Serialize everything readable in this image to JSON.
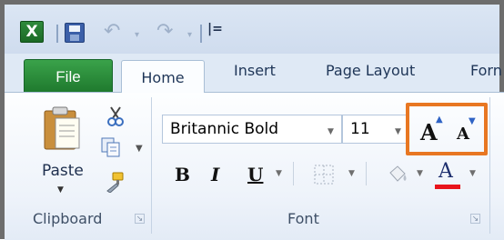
{
  "app": {
    "logo_letter": "X"
  },
  "quick_access": {
    "customize_glyph": "|=",
    "icons": [
      "excel-logo-icon",
      "save-icon",
      "undo-icon",
      "redo-icon"
    ]
  },
  "tabs": {
    "file": "File",
    "home": "Home",
    "insert": "Insert",
    "page_layout": "Page Layout",
    "formulas_partial": "Forn"
  },
  "clipboard": {
    "paste_label": "Paste",
    "group_label": "Clipboard",
    "icons": [
      "cut-icon",
      "copy-icon",
      "format-painter-icon"
    ]
  },
  "font": {
    "group_label": "Font",
    "font_name": "Britannic Bold",
    "font_size": "11",
    "bold_label": "B",
    "italic_label": "I",
    "underline_label": "U",
    "grow_font_label": "A",
    "shrink_font_label": "A",
    "font_color_label": "A",
    "font_color": "#e8141b"
  },
  "colors": {
    "file_tab": "#2a8f3a",
    "highlight": "#e87722",
    "ribbon": "#eef3fa"
  }
}
